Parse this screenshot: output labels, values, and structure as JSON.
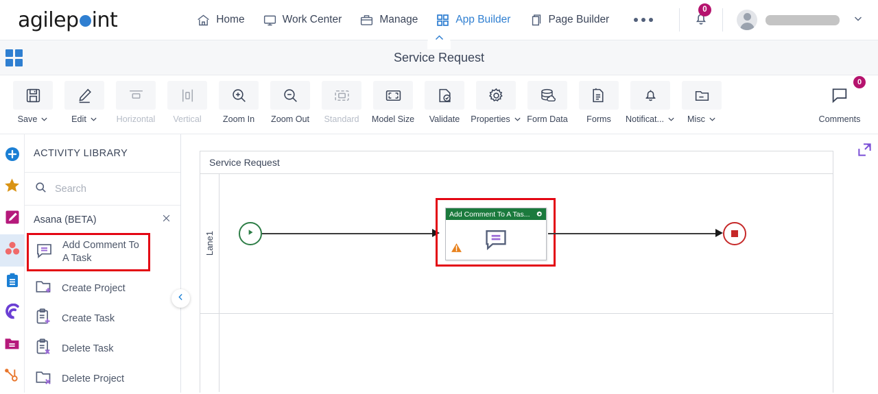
{
  "brand": {
    "logo_pre": "agilep",
    "logo_post": "int",
    "accent": "#2f7fd1"
  },
  "topnav": {
    "items": [
      {
        "label": "Home",
        "icon": "home-icon",
        "active": false
      },
      {
        "label": "Work Center",
        "icon": "monitor-icon",
        "active": false
      },
      {
        "label": "Manage",
        "icon": "briefcase-icon",
        "active": false
      },
      {
        "label": "App Builder",
        "icon": "grid-icon",
        "active": true
      },
      {
        "label": "Page Builder",
        "icon": "pages-icon",
        "active": false
      }
    ],
    "more_label": "More options",
    "notifications_count": "0",
    "user_menu_label": ""
  },
  "titlebar": {
    "title": "Service Request",
    "apps_icon": "apps-grid-icon",
    "collapse_icon": "chevron-up-icon"
  },
  "toolbar": {
    "buttons": [
      {
        "label": "Save",
        "icon": "save-icon",
        "caret": true,
        "disabled": false
      },
      {
        "label": "Edit",
        "icon": "pencil-icon",
        "caret": true,
        "disabled": false
      },
      {
        "label": "Horizontal",
        "icon": "horizontal-align-icon",
        "caret": false,
        "disabled": true
      },
      {
        "label": "Vertical",
        "icon": "vertical-align-icon",
        "caret": false,
        "disabled": true
      },
      {
        "label": "Zoom In",
        "icon": "zoom-in-icon",
        "caret": false,
        "disabled": false
      },
      {
        "label": "Zoom Out",
        "icon": "zoom-out-icon",
        "caret": false,
        "disabled": false
      },
      {
        "label": "Standard",
        "icon": "standard-size-icon",
        "caret": false,
        "disabled": true
      },
      {
        "label": "Model Size",
        "icon": "model-size-icon",
        "caret": false,
        "disabled": false
      },
      {
        "label": "Validate",
        "icon": "validate-icon",
        "caret": false,
        "disabled": false
      },
      {
        "label": "Properties",
        "icon": "gear-icon",
        "caret": true,
        "disabled": false
      },
      {
        "label": "Form Data",
        "icon": "database-icon",
        "caret": false,
        "disabled": false
      },
      {
        "label": "Forms",
        "icon": "forms-icon",
        "caret": false,
        "disabled": false
      },
      {
        "label": "Notificat...",
        "icon": "bell-icon",
        "caret": true,
        "disabled": false
      },
      {
        "label": "Misc",
        "icon": "folder-icon",
        "caret": true,
        "disabled": false
      }
    ],
    "comments": {
      "label": "Comments",
      "icon": "comment-icon",
      "count": "0"
    }
  },
  "rail": {
    "items": [
      {
        "name": "add-activity",
        "icon": "plus-circle-icon",
        "color": "#1b7fd4",
        "selected": false
      },
      {
        "name": "favorites",
        "icon": "star-icon",
        "color": "#d99314",
        "selected": false
      },
      {
        "name": "custom-activity",
        "icon": "edit-square-icon",
        "color": "#b5197b",
        "selected": false
      },
      {
        "name": "asana",
        "icon": "asana-icon",
        "color": "#f06a6a",
        "selected": true
      },
      {
        "name": "clipboard",
        "icon": "clipboard-icon",
        "color": "#1b7fd4",
        "selected": false
      },
      {
        "name": "appian",
        "icon": "swirl-icon",
        "color": "#6b3fd4",
        "selected": false
      },
      {
        "name": "box",
        "icon": "folder-filled-icon",
        "color": "#b5197b",
        "selected": false
      },
      {
        "name": "hubspot",
        "icon": "hubspot-icon",
        "color": "#e8762c",
        "selected": false
      }
    ]
  },
  "library": {
    "title": "ACTIVITY LIBRARY",
    "search": {
      "placeholder": "Search",
      "value": "",
      "icon": "search-icon"
    },
    "group": {
      "label": "Asana (BETA)",
      "close_icon": "close-icon"
    },
    "items": [
      {
        "label": "Add Comment To A Task",
        "icon": "comment-activity-icon",
        "highlighted": true
      },
      {
        "label": "Create Project",
        "icon": "folder-plus-icon",
        "highlighted": false
      },
      {
        "label": "Create Task",
        "icon": "clipboard-plus-icon",
        "highlighted": false
      },
      {
        "label": "Delete Task",
        "icon": "clipboard-x-icon",
        "highlighted": false
      },
      {
        "label": "Delete Project",
        "icon": "folder-x-icon",
        "highlighted": false
      }
    ],
    "collapse_icon": "chevron-left-icon"
  },
  "canvas": {
    "pool_title": "Service Request",
    "lane_label": "Lane1",
    "expand_icon": "expand-icon",
    "nodes": [
      {
        "type": "start-event",
        "name": "start-event",
        "color": "#2d7d46"
      },
      {
        "type": "activity",
        "name": "add-comment-to-a-task-activity",
        "title": "Add Comment To A Tas...",
        "header_color": "#1b7a3d",
        "selected": true,
        "has_warning": true,
        "gear_icon": "gear-icon",
        "warning_icon": "warning-icon",
        "body_icon": "comment-activity-icon"
      },
      {
        "type": "end-event",
        "name": "end-event",
        "color": "#c62828"
      }
    ]
  }
}
